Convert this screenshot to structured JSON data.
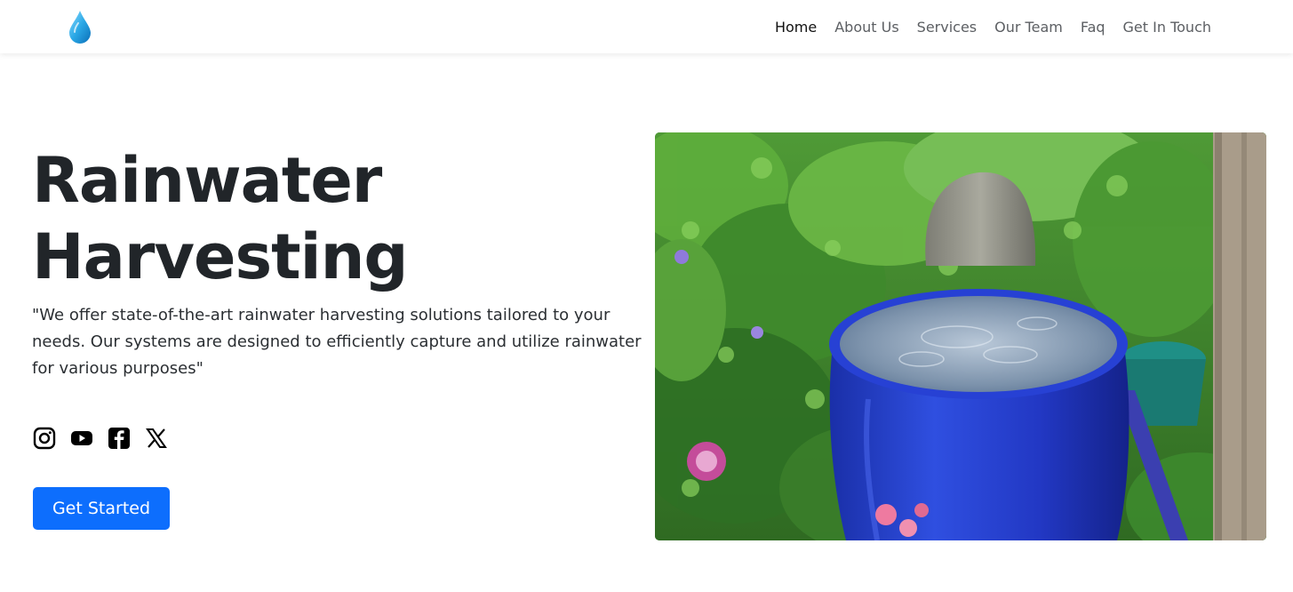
{
  "nav": {
    "logo_icon": "water-drop-icon",
    "links": [
      {
        "label": "Home",
        "active": true
      },
      {
        "label": "About Us",
        "active": false
      },
      {
        "label": "Services",
        "active": false
      },
      {
        "label": "Our Team",
        "active": false
      },
      {
        "label": "Faq",
        "active": false
      },
      {
        "label": "Get In Touch",
        "active": false
      }
    ]
  },
  "hero": {
    "title_line1": "Rainwater",
    "title_line2": "Harvesting",
    "description": "\"We offer state-of-the-art rainwater harvesting solutions tailored to your needs. Our systems are designed to efficiently capture and utilize rainwater for various purposes\"",
    "social_icons": [
      "instagram-icon",
      "youtube-icon",
      "facebook-icon",
      "x-icon"
    ],
    "cta_label": "Get Started",
    "image_alt": "blue-rain-barrel-photo"
  },
  "colors": {
    "accent": "#0d6efd",
    "text_dark": "#212529",
    "nav_text": "#5c5f63"
  }
}
